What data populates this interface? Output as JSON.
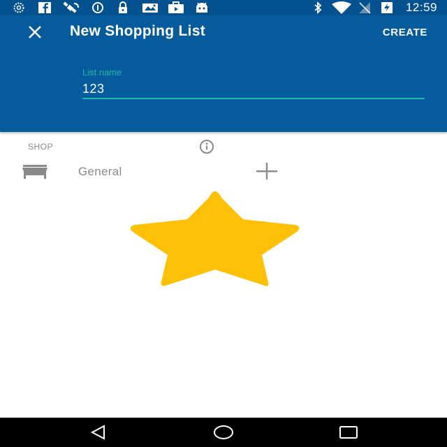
{
  "status_bar": {
    "time": "12:59",
    "icons": [
      "spinner-icon",
      "facebook-icon",
      "satellite-icon",
      "data-saver-icon",
      "lock-icon",
      "photo-icon",
      "briefcase-icon",
      "android-icon",
      "bluetooth-icon",
      "wifi-icon",
      "no-signal-icon",
      "battery-charging-icon"
    ]
  },
  "app_bar": {
    "title": "New Shopping List",
    "close_icon": "close-icon",
    "create_label": "CREATE",
    "background": "#055b9c"
  },
  "form": {
    "list_name_label": "List name",
    "list_name_value": "123",
    "accent": "#20b8a8"
  },
  "shop_section": {
    "header": "SHOP",
    "info_icon": "info-icon",
    "items": [
      {
        "icon": "store-icon",
        "name": "General",
        "action_icon": "plus-icon"
      }
    ]
  },
  "overlay": {
    "icon": "star-icon",
    "color": "#ffc107"
  },
  "nav_bar": {
    "buttons": [
      "back-icon",
      "home-icon",
      "recents-icon"
    ]
  }
}
